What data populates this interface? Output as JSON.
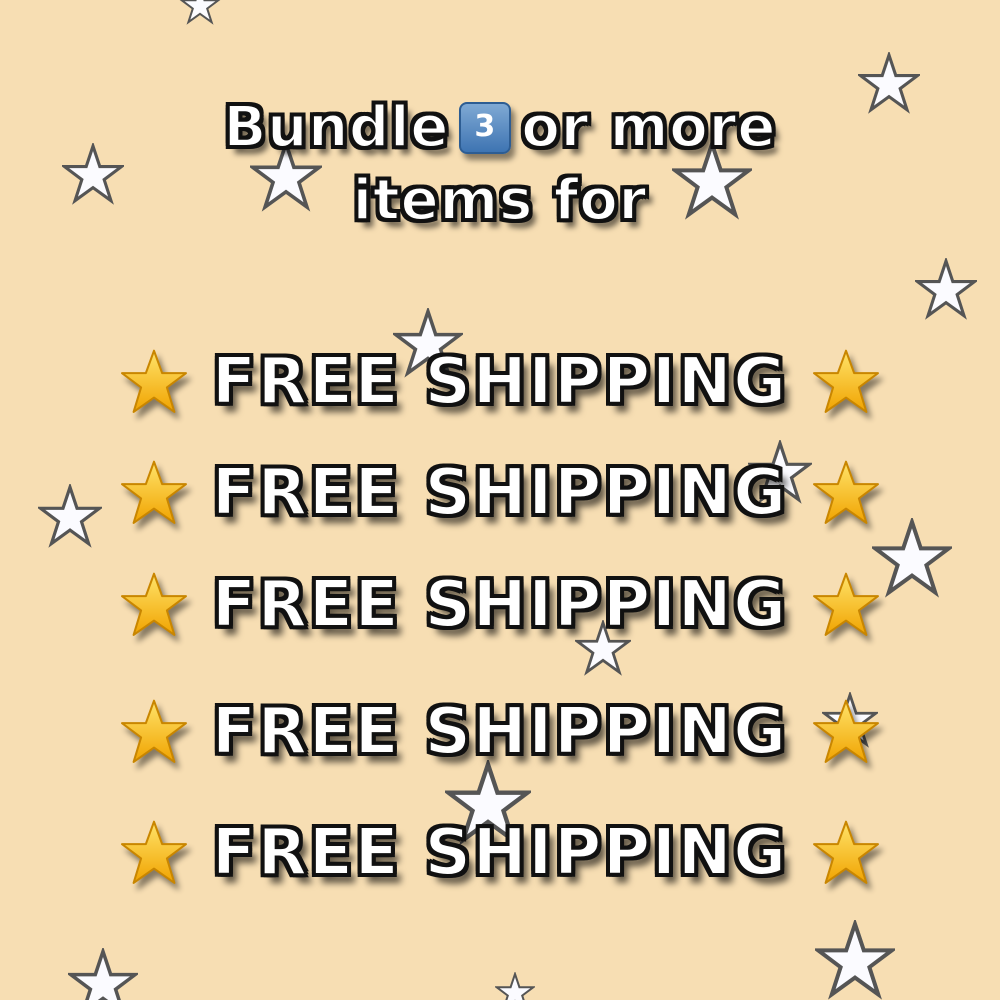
{
  "headline": {
    "line1_before": "Bundle",
    "keycap_number": "3",
    "line1_after": "or more",
    "line2": "items for"
  },
  "offer_rows": [
    {
      "label": "FREE SHIPPING",
      "icon": "gold-star-icon"
    },
    {
      "label": "FREE SHIPPING",
      "icon": "gold-star-icon"
    },
    {
      "label": "FREE SHIPPING",
      "icon": "gold-star-icon"
    },
    {
      "label": "FREE SHIPPING",
      "icon": "gold-star-icon"
    },
    {
      "label": "FREE SHIPPING",
      "icon": "gold-star-icon"
    }
  ],
  "colors": {
    "background": "#f7deb3",
    "text_fill": "#ffffff",
    "text_outline": "#111111",
    "gold_star": "#f5b80f",
    "keycap": "#4a7fbd"
  }
}
